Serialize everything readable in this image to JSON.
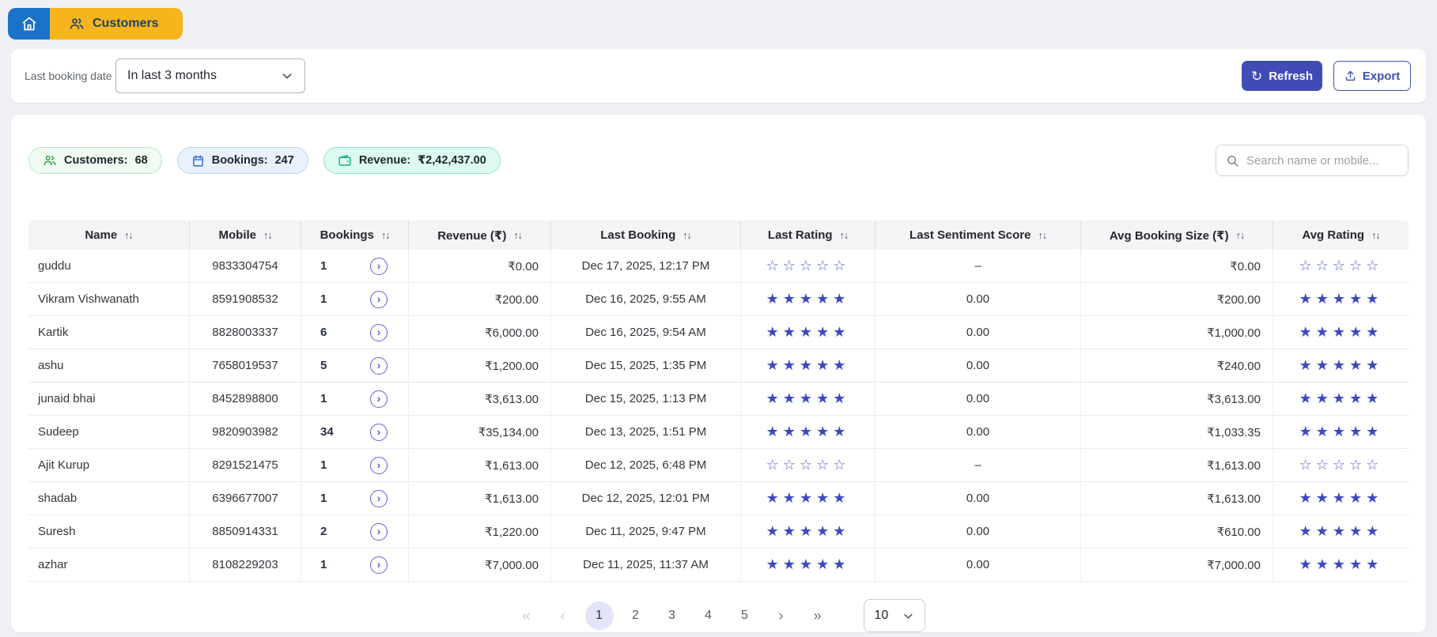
{
  "nav": {
    "customers_tab": "Customers"
  },
  "filters": {
    "label": "Last booking date",
    "selected_value": "In last 3 months",
    "refresh_label": "Refresh",
    "export_label": "Export"
  },
  "stats": {
    "customers": {
      "label": "Customers:",
      "value": "68"
    },
    "bookings": {
      "label": "Bookings:",
      "value": "247"
    },
    "revenue": {
      "label": "Revenue:",
      "value": "₹2,42,437.00"
    }
  },
  "search": {
    "placeholder": "Search name or mobile..."
  },
  "table": {
    "columns": [
      "Name",
      "Mobile",
      "Bookings",
      "Revenue (₹)",
      "Last Booking",
      "Last Rating",
      "Last Sentiment Score",
      "Avg Booking Size (₹)",
      "Avg Rating"
    ],
    "sort_icon": "↑↓",
    "rows": [
      {
        "name": "guddu",
        "mobile": "9833304754",
        "bookings": "1",
        "revenue": "₹0.00",
        "last_booking": "Dec 17, 2025, 12:17 PM",
        "last_rating": 0,
        "last_sentiment": "–",
        "avg_booking_size": "₹0.00",
        "avg_rating": 0
      },
      {
        "name": "Vikram Vishwanath",
        "mobile": "8591908532",
        "bookings": "1",
        "revenue": "₹200.00",
        "last_booking": "Dec 16, 2025, 9:55 AM",
        "last_rating": 5,
        "last_sentiment": "0.00",
        "avg_booking_size": "₹200.00",
        "avg_rating": 5
      },
      {
        "name": "Kartik",
        "mobile": "8828003337",
        "bookings": "6",
        "revenue": "₹6,000.00",
        "last_booking": "Dec 16, 2025, 9:54 AM",
        "last_rating": 5,
        "last_sentiment": "0.00",
        "avg_booking_size": "₹1,000.00",
        "avg_rating": 5
      },
      {
        "name": "ashu",
        "mobile": "7658019537",
        "bookings": "5",
        "revenue": "₹1,200.00",
        "last_booking": "Dec 15, 2025, 1:35 PM",
        "last_rating": 5,
        "last_sentiment": "0.00",
        "avg_booking_size": "₹240.00",
        "avg_rating": 5
      },
      {
        "name": "junaid bhai",
        "mobile": "8452898800",
        "bookings": "1",
        "revenue": "₹3,613.00",
        "last_booking": "Dec 15, 2025, 1:13 PM",
        "last_rating": 5,
        "last_sentiment": "0.00",
        "avg_booking_size": "₹3,613.00",
        "avg_rating": 5
      },
      {
        "name": "Sudeep",
        "mobile": "9820903982",
        "bookings": "34",
        "revenue": "₹35,134.00",
        "last_booking": "Dec 13, 2025, 1:51 PM",
        "last_rating": 5,
        "last_sentiment": "0.00",
        "avg_booking_size": "₹1,033.35",
        "avg_rating": 5
      },
      {
        "name": "Ajit Kurup",
        "mobile": "8291521475",
        "bookings": "1",
        "revenue": "₹1,613.00",
        "last_booking": "Dec 12, 2025, 6:48 PM",
        "last_rating": 0,
        "last_sentiment": "–",
        "avg_booking_size": "₹1,613.00",
        "avg_rating": 0
      },
      {
        "name": "shadab",
        "mobile": "6396677007",
        "bookings": "1",
        "revenue": "₹1,613.00",
        "last_booking": "Dec 12, 2025, 12:01 PM",
        "last_rating": 5,
        "last_sentiment": "0.00",
        "avg_booking_size": "₹1,613.00",
        "avg_rating": 5
      },
      {
        "name": "Suresh",
        "mobile": "8850914331",
        "bookings": "2",
        "revenue": "₹1,220.00",
        "last_booking": "Dec 11, 2025, 9:47 PM",
        "last_rating": 5,
        "last_sentiment": "0.00",
        "avg_booking_size": "₹610.00",
        "avg_rating": 5
      },
      {
        "name": "azhar",
        "mobile": "8108229203",
        "bookings": "1",
        "revenue": "₹7,000.00",
        "last_booking": "Dec 11, 2025, 11:37 AM",
        "last_rating": 5,
        "last_sentiment": "0.00",
        "avg_booking_size": "₹7,000.00",
        "avg_rating": 5
      }
    ]
  },
  "pagination": {
    "first": "«",
    "prev": "‹",
    "next": "›",
    "last": "»",
    "pages": [
      "1",
      "2",
      "3",
      "4",
      "5"
    ],
    "active": "1",
    "page_size": "10"
  },
  "colors": {
    "home_blue": "#1a73c9",
    "tab_orange": "#f7b51d",
    "accent_indigo": "#3f4cb5",
    "star_filled": "#3c49c0",
    "star_empty": "#5a64d0",
    "badge_green_icon": "#2aa14a",
    "badge_blue_icon": "#2d6ce0",
    "badge_teal_icon": "#12b886",
    "active_page_bg": "#e3e4f7"
  }
}
